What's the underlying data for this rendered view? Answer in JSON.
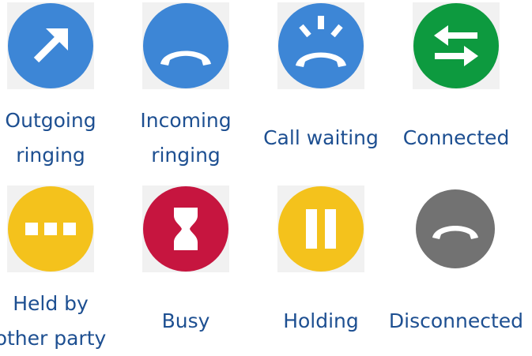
{
  "colors": {
    "blue": "#3d86d6",
    "green": "#0d9a3f",
    "yellow": "#f4c21c",
    "red": "#c6153f",
    "gray": "#727272",
    "label_text": "#1d4f91",
    "tile_bg": "#f1f1f1"
  },
  "statuses": [
    {
      "line1": "Outgoing",
      "line2": "ringing",
      "icon": "outgoing-arrow-icon"
    },
    {
      "line1": "Incoming",
      "line2": "ringing",
      "icon": "phone-handset-icon"
    },
    {
      "line1": "Call waiting",
      "line2": "",
      "icon": "phone-ringing-icon"
    },
    {
      "line1": "Connected",
      "line2": "",
      "icon": "swap-arrows-icon"
    },
    {
      "line1": "Held by",
      "line2": "other party",
      "icon": "dots-icon"
    },
    {
      "line1": "Busy",
      "line2": "",
      "icon": "hourglass-icon"
    },
    {
      "line1": "Holding",
      "line2": "",
      "icon": "pause-icon"
    },
    {
      "line1": "Disconnected",
      "line2": "",
      "icon": "phone-hangup-icon"
    }
  ]
}
